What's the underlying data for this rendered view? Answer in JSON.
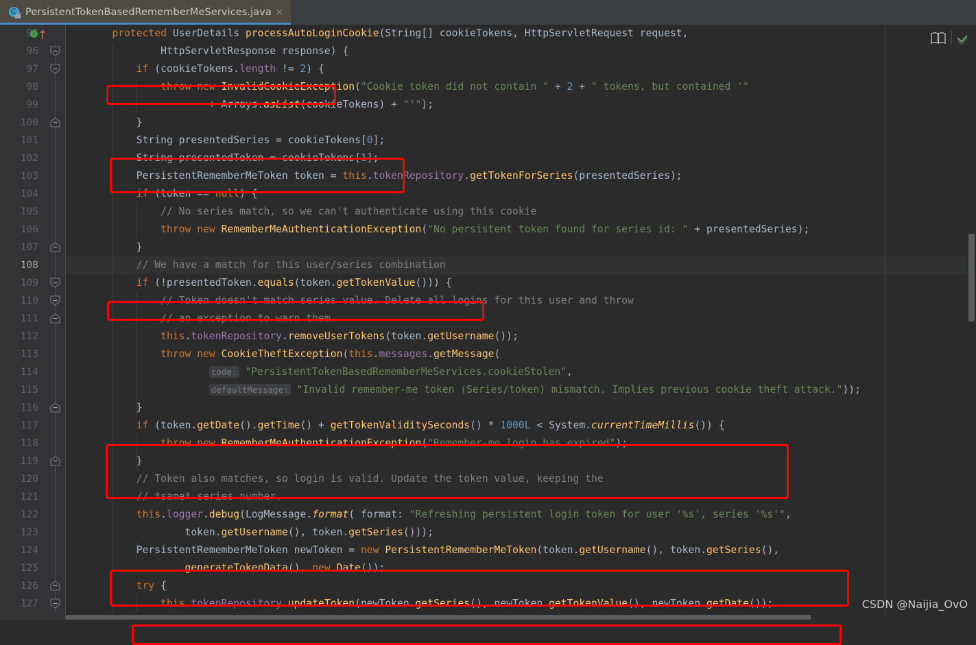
{
  "window": {
    "tab": {
      "label": "PersistentTokenBasedRememberMeServices.java",
      "icon": "java-class-locked-icon",
      "close_label": "×",
      "active_underline_color": "#4a88c7",
      "active_bg_color": "#4e4a41"
    }
  },
  "editor": {
    "theme": "darcula",
    "background": "#2b2b2b",
    "gutter_background": "#313335",
    "current_line": 108,
    "first_visible_line": 95,
    "last_visible_line": 127,
    "right_toolbar": {
      "reader_mode_icon": "book-icon",
      "inspection_status_icon": "green-check-icon",
      "inspection_status_color": "#5a9c5a"
    },
    "syntax_colors": {
      "keyword": "#cc7832",
      "identifier": "#a9b7c6",
      "method": "#ffc66d",
      "field": "#9876aa",
      "string": "#6a8759",
      "number": "#6897bb",
      "comment": "#808080",
      "hint_text": "#787878",
      "hint_bg": "#3c3f41"
    },
    "annotation_color": "#fe0000",
    "line_numbers": [
      95,
      96,
      97,
      98,
      99,
      100,
      101,
      102,
      103,
      104,
      105,
      106,
      107,
      108,
      109,
      110,
      111,
      112,
      113,
      114,
      115,
      116,
      117,
      118,
      119,
      120,
      121,
      122,
      123,
      124,
      125,
      126,
      127
    ],
    "gutter_markers": {
      "line_95": [
        "implementing-method-icon",
        "override-arrow-icon"
      ],
      "fold_open_lines": [
        96,
        97,
        109,
        110,
        127
      ],
      "fold_close_lines": [
        100,
        107,
        111,
        116,
        119,
        126
      ]
    },
    "code_lines": [
      "    protected UserDetails processAutoLoginCookie(String[] cookieTokens, HttpServletRequest request,",
      "            HttpServletResponse response) {",
      "        if (cookieTokens.length != 2) {",
      "            throw new InvalidCookieException(\"Cookie token did not contain \" + 2 + \" tokens, but contained '\"",
      "                    + Arrays.asList(cookieTokens) + \"'\");",
      "        }",
      "        String presentedSeries = cookieTokens[0];",
      "        String presentedToken = cookieTokens[1];",
      "        PersistentRememberMeToken token = this.tokenRepository.getTokenForSeries(presentedSeries);",
      "        if (token == null) {",
      "            // No series match, so we can't authenticate using this cookie",
      "            throw new RememberMeAuthenticationException(\"No persistent token found for series id: \" + presentedSeries);",
      "        }",
      "        // We have a match for this user/series combination",
      "        if (!presentedToken.equals(token.getTokenValue())) {",
      "            // Token doesn't match series value. Delete all logins for this user and throw",
      "            // an exception to warn them.",
      "            this.tokenRepository.removeUserTokens(token.getUsername());",
      "            throw new CookieTheftException(this.messages.getMessage(",
      "                    code: \"PersistentTokenBasedRememberMeServices.cookieStolen\",",
      "                    defaultMessage: \"Invalid remember-me token (Series/token) mismatch. Implies previous cookie theft attack.\"));",
      "        }",
      "        if (token.getDate().getTime() + getTokenValiditySeconds() * 1000L < System.currentTimeMillis()) {",
      "            throw new RememberMeAuthenticationException(\"Remember-me login has expired\");",
      "        }",
      "        // Token also matches, so login is valid. Update the token value, keeping the",
      "        // *same* series number.",
      "        this.logger.debug(LogMessage.format( format: \"Refreshing persistent login token for user '%s', series '%s'\",",
      "                token.getUsername(), token.getSeries()));",
      "        PersistentRememberMeToken newToken = new PersistentRememberMeToken(token.getUsername(), token.getSeries(),",
      "                generateTokenData(), new Date());",
      "        try {",
      "            this.tokenRepository.updateToken(newToken.getSeries(), newToken.getTokenValue(), newToken.getDate());"
    ],
    "inlay_hints": [
      {
        "line": 114,
        "text": "code:"
      },
      {
        "line": 115,
        "text": "defaultMessage:"
      },
      {
        "line": 122,
        "text": "format:"
      }
    ],
    "highlight_boxes": [
      {
        "label": "cookie-token-length-check",
        "lines": "97"
      },
      {
        "label": "presented-series-token-assign",
        "lines": "101-102"
      },
      {
        "label": "token-equals-check",
        "lines": "109"
      },
      {
        "label": "token-expiry-check",
        "lines": "117-119"
      },
      {
        "label": "new-token-construction",
        "lines": "124-125"
      },
      {
        "label": "update-token-call",
        "lines": "127"
      }
    ]
  },
  "watermark": {
    "text": "CSDN @Naijia_OvO"
  }
}
